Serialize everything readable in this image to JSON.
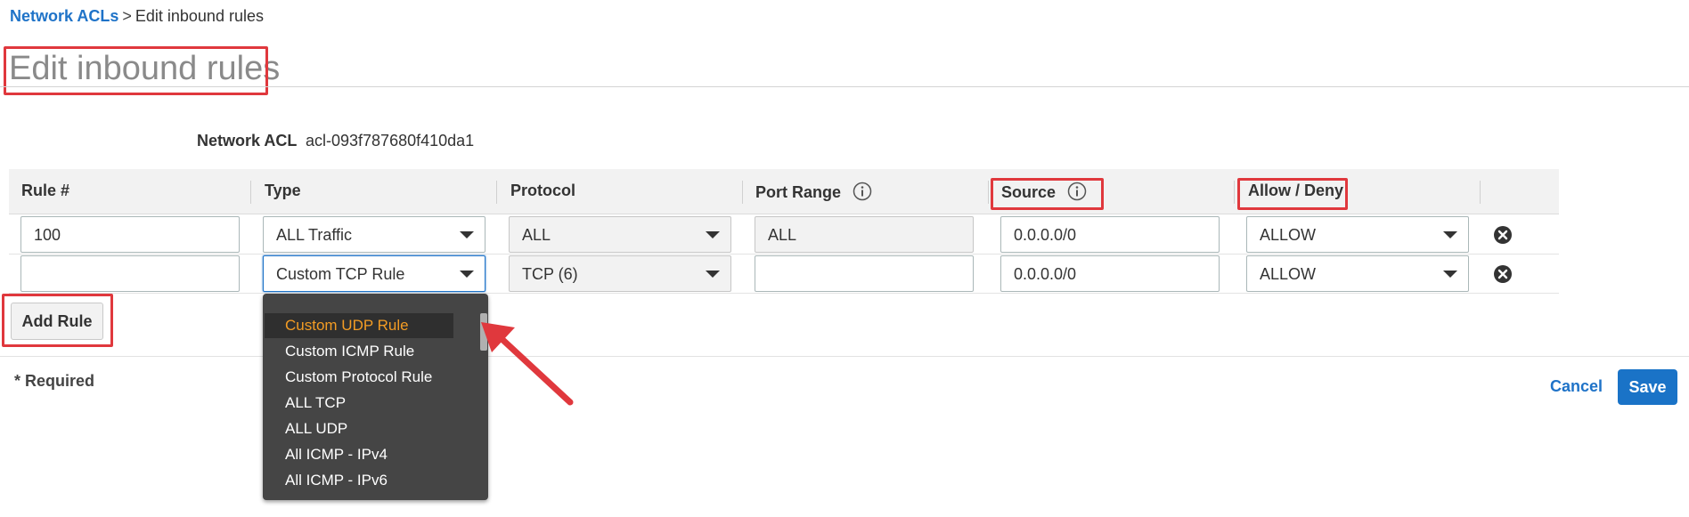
{
  "breadcrumb": {
    "parent": "Network ACLs",
    "separator": ">",
    "current": "Edit inbound rules"
  },
  "page_title": "Edit inbound rules",
  "network_acl": {
    "label": "Network ACL",
    "value": "acl-093f787680f410da1"
  },
  "table": {
    "headers": {
      "rule": "Rule #",
      "type": "Type",
      "protocol": "Protocol",
      "port_range": "Port Range",
      "source": "Source",
      "allow_deny": "Allow / Deny"
    },
    "rows": [
      {
        "rule": "100",
        "type": "ALL Traffic",
        "protocol": "ALL",
        "port_range": "ALL",
        "source": "0.0.0.0/0",
        "allow_deny": "ALLOW"
      },
      {
        "rule": "",
        "type": "Custom TCP Rule",
        "protocol": "TCP (6)",
        "port_range": "",
        "source": "0.0.0.0/0",
        "allow_deny": "ALLOW"
      }
    ]
  },
  "type_dropdown_options": [
    "Custom UDP Rule",
    "Custom ICMP Rule",
    "Custom Protocol Rule",
    "ALL TCP",
    "ALL UDP",
    "All ICMP - IPv4",
    "All ICMP - IPv6"
  ],
  "buttons": {
    "add_rule": "Add Rule",
    "cancel": "Cancel",
    "save": "Save"
  },
  "required_note": "* Required",
  "colors": {
    "link": "#1f73c8",
    "primary_button": "#1a73c7",
    "highlight_annotation": "#e0383d",
    "dropdown_bg": "#454545",
    "dropdown_highlight_text": "#f39c24"
  },
  "icons": {
    "info": "info-icon",
    "remove": "remove-circle-x-icon",
    "select_caret": "caret-down-icon",
    "annotation_arrow": "arrow-icon"
  }
}
